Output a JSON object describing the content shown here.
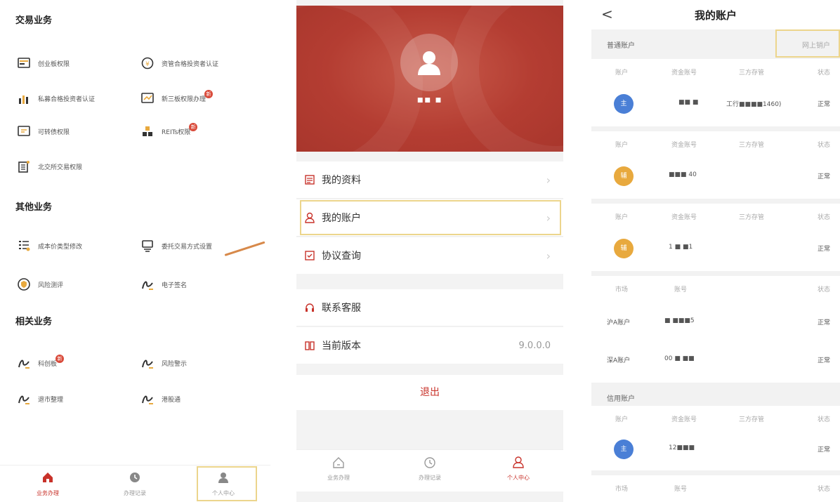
{
  "panel1": {
    "trade_section": "交易业务",
    "trade_items": [
      {
        "label": "创业板权限",
        "icon": "chinext-icon"
      },
      {
        "label": "资管合格投资者认证",
        "icon": "asset-mgmt-icon"
      },
      {
        "label": "私募合格投资者认证",
        "icon": "private-fund-icon"
      },
      {
        "label": "新三板权限办理",
        "icon": "neeq-icon",
        "badge": "新"
      },
      {
        "label": "可转债权限",
        "icon": "convertible-bond-icon"
      },
      {
        "label": "REITs权限",
        "icon": "reits-icon",
        "badge": "新"
      },
      {
        "label": "北交所交易权限",
        "icon": "bse-icon"
      }
    ],
    "other_section": "其他业务",
    "other_items": [
      {
        "label": "成本价类型修改",
        "icon": "cost-type-icon"
      },
      {
        "label": "委托交易方式设置",
        "icon": "order-method-icon"
      },
      {
        "label": "风险测评",
        "icon": "risk-assess-icon"
      },
      {
        "label": "电子签名",
        "icon": "signature-icon"
      }
    ],
    "related_section": "相关业务",
    "related_items": [
      {
        "label": "科创板",
        "icon": "star-market-icon",
        "badge": "新"
      },
      {
        "label": "风险警示",
        "icon": "risk-warning-icon"
      },
      {
        "label": "退市整理",
        "icon": "delisting-icon"
      },
      {
        "label": "港股通",
        "icon": "hk-connect-icon"
      }
    ],
    "tabs": [
      {
        "label": "业务办理",
        "icon": "home-icon",
        "active": true
      },
      {
        "label": "办理记录",
        "icon": "clock-icon",
        "active": false
      },
      {
        "label": "个人中心",
        "icon": "person-icon",
        "active": false
      }
    ]
  },
  "panel2": {
    "username": "■■ ■",
    "menu": [
      {
        "label": "我的资料",
        "icon": "profile-icon"
      },
      {
        "label": "我的账户",
        "icon": "account-icon"
      },
      {
        "label": "协议查询",
        "icon": "agreement-icon"
      },
      {
        "label": "联系客服",
        "icon": "headset-icon"
      },
      {
        "label": "当前版本",
        "icon": "version-icon",
        "value": "9.0.0.0"
      }
    ],
    "logout": "退出",
    "tabs": [
      {
        "label": "业务办理",
        "icon": "home-icon",
        "active": false
      },
      {
        "label": "办理记录",
        "icon": "clock-icon",
        "active": false
      },
      {
        "label": "个人中心",
        "icon": "person-icon",
        "active": true
      }
    ]
  },
  "panel3": {
    "title": "我的账户",
    "back": "<",
    "normal_accounts": "普通账户",
    "online_close": "网上销户",
    "col_account": "账户",
    "col_fund_no": "资金账号",
    "col_depository": "三方存管",
    "col_status": "状态",
    "col_market": "市场",
    "col_number": "账号",
    "rows": [
      {
        "avatar": "主",
        "color": "#4a7fd6",
        "fund": "■■ ■",
        "depository": "工行■■■■1460)",
        "status": "正常"
      },
      {
        "avatar": "辅",
        "color": "#e8a93e",
        "fund": "■■■ 40",
        "depository": "",
        "status": "正常"
      },
      {
        "avatar": "辅",
        "color": "#e8a93e",
        "fund": "1 ■ ■1",
        "depository": "",
        "status": "正常"
      }
    ],
    "markets": [
      {
        "market": "沪A账户",
        "number": "■ ■■■5",
        "status": "正常"
      },
      {
        "market": "深A账户",
        "number": "00 ■ ■■",
        "status": "正常"
      }
    ],
    "credit_accounts": "信用账户",
    "credit_row": {
      "avatar": "主",
      "color": "#4a7fd6",
      "fund": "12■■■",
      "status": "正常"
    },
    "bottom_col_market": "市场",
    "bottom_col_number": "账号",
    "bottom_col_status": "状态"
  },
  "colors": {
    "brand": "#c8322a",
    "highlight": "#ecd58c"
  }
}
